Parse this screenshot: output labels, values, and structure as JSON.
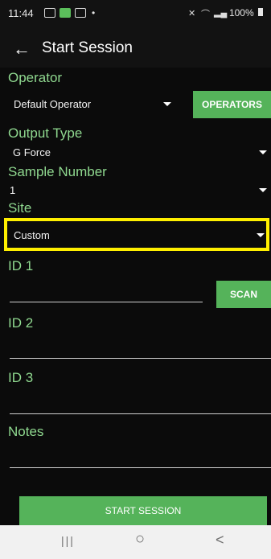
{
  "status": {
    "time": "11:44",
    "dot": "•",
    "right": "100%"
  },
  "appbar": {
    "back_icon": "←",
    "title": "Start Session"
  },
  "operator": {
    "label": "Operator",
    "value": "Default Operator",
    "button": "OPERATORS"
  },
  "output_type": {
    "label": "Output Type",
    "value": "G Force"
  },
  "sample_number": {
    "label": "Sample Number",
    "value": "1"
  },
  "site": {
    "label": "Site",
    "value": "Custom",
    "highlight_color": "#ffef00"
  },
  "id1": {
    "label": "ID 1",
    "value": "",
    "button": "SCAN"
  },
  "id2": {
    "label": "ID 2",
    "value": ""
  },
  "id3": {
    "label": "ID 3",
    "value": ""
  },
  "notes": {
    "label": "Notes",
    "value": ""
  },
  "start_button": {
    "label": "START SESSION"
  },
  "colors": {
    "accent": "#55b35a",
    "label": "#8fd88f"
  },
  "navbar": {
    "recent": "|||",
    "home": "○",
    "back": "<"
  }
}
